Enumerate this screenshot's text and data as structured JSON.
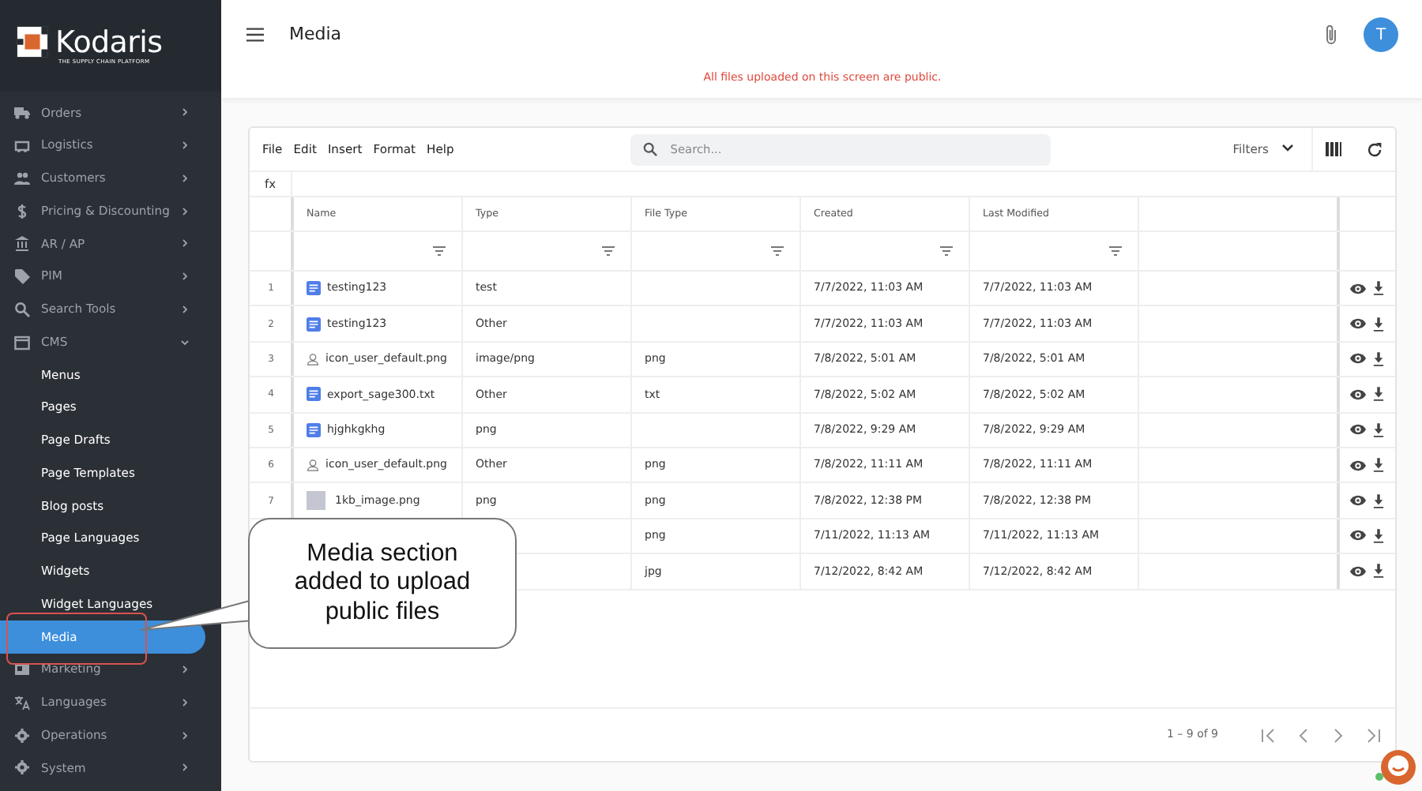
{
  "logo": {
    "name": "Kodaris",
    "tagline": "THE SUPPLY CHAIN PLATFORM"
  },
  "sidebar": {
    "items": [
      {
        "label": "Orders",
        "kind": "main",
        "expanded": false,
        "selected": false
      },
      {
        "label": "Logistics",
        "kind": "main",
        "expanded": false,
        "selected": false
      },
      {
        "label": "Customers",
        "kind": "main",
        "expanded": false,
        "selected": false
      },
      {
        "label": "Pricing & Discounting",
        "kind": "main",
        "expanded": false,
        "selected": false
      },
      {
        "label": "AR / AP",
        "kind": "main",
        "expanded": false,
        "selected": false
      },
      {
        "label": "PIM",
        "kind": "main",
        "expanded": false,
        "selected": false
      },
      {
        "label": "Search Tools",
        "kind": "main",
        "expanded": false,
        "selected": false
      },
      {
        "label": "CMS",
        "kind": "main",
        "expanded": true,
        "selected": false
      },
      {
        "label": "Menus",
        "kind": "sub",
        "selected": false
      },
      {
        "label": "Pages",
        "kind": "sub",
        "selected": false
      },
      {
        "label": "Page Drafts",
        "kind": "sub",
        "selected": false
      },
      {
        "label": "Page Templates",
        "kind": "sub",
        "selected": false
      },
      {
        "label": "Blog posts",
        "kind": "sub",
        "selected": false
      },
      {
        "label": "Page Languages",
        "kind": "sub",
        "selected": false
      },
      {
        "label": "Widgets",
        "kind": "sub",
        "selected": false
      },
      {
        "label": "Widget Languages",
        "kind": "sub",
        "selected": false
      },
      {
        "label": "Media",
        "kind": "sub",
        "selected": true
      },
      {
        "label": "Marketing",
        "kind": "main",
        "expanded": false,
        "selected": false
      },
      {
        "label": "Languages",
        "kind": "main",
        "expanded": false,
        "selected": false
      },
      {
        "label": "Operations",
        "kind": "main",
        "expanded": false,
        "selected": false
      },
      {
        "label": "System",
        "kind": "main",
        "expanded": false,
        "selected": false
      }
    ]
  },
  "header": {
    "title": "Media",
    "avatar": "T",
    "notice": "All files uploaded on this screen are public."
  },
  "toolbar": {
    "menus": [
      "File",
      "Edit",
      "Insert",
      "Format",
      "Help"
    ],
    "search_placeholder": "Search...",
    "filters": "Filters",
    "formula_label": "fx"
  },
  "table": {
    "columns": [
      "Name",
      "Type",
      "File Type",
      "Created",
      "Last Modified"
    ],
    "rows": [
      {
        "number": "1",
        "kind": "doc",
        "name": "testing123",
        "type": "test",
        "created": "7/7/2022, 11:03 AM",
        "modified": "7/7/2022, 11:03 AM"
      },
      {
        "number": "2",
        "kind": "doc",
        "name": "testing123",
        "type": "Other",
        "created": "7/7/2022, 11:03 AM",
        "modified": "7/7/2022, 11:03 AM"
      },
      {
        "number": "3",
        "kind": "user",
        "name": "icon_user_default.png",
        "type": "image/png",
        "file_type": "png",
        "created": "7/8/2022, 5:01 AM",
        "modified": "7/8/2022, 5:01 AM"
      },
      {
        "number": "4",
        "kind": "doc",
        "name": "export_sage300.txt",
        "type": "Other",
        "file_type": "txt",
        "created": "7/8/2022, 5:02 AM",
        "modified": "7/8/2022, 5:02 AM"
      },
      {
        "number": "5",
        "kind": "doc",
        "name": "hjghkgkhg",
        "type": "png",
        "created": "7/8/2022, 9:29 AM",
        "modified": "7/8/2022, 9:29 AM"
      },
      {
        "number": "6",
        "kind": "user",
        "name": "icon_user_default.png",
        "type": "Other",
        "file_type": "png",
        "created": "7/8/2022, 11:11 AM",
        "modified": "7/8/2022, 11:11 AM"
      },
      {
        "number": "7",
        "kind": "image",
        "name": "1kb_image.png",
        "type": "png",
        "file_type": "png",
        "created": "7/8/2022, 12:38 PM",
        "modified": "7/8/2022, 12:38 PM"
      },
      {
        "file_type": "png",
        "created": "7/11/2022, 11:13 AM",
        "modified": "7/11/2022, 11:13 AM"
      },
      {
        "file_type": "jpg",
        "created": "7/12/2022, 8:42 AM",
        "modified": "7/12/2022, 8:42 AM"
      }
    ]
  },
  "pagination": {
    "range": "1 – 9 of 9"
  },
  "callout": {
    "text": "Media section added to upload public files"
  }
}
